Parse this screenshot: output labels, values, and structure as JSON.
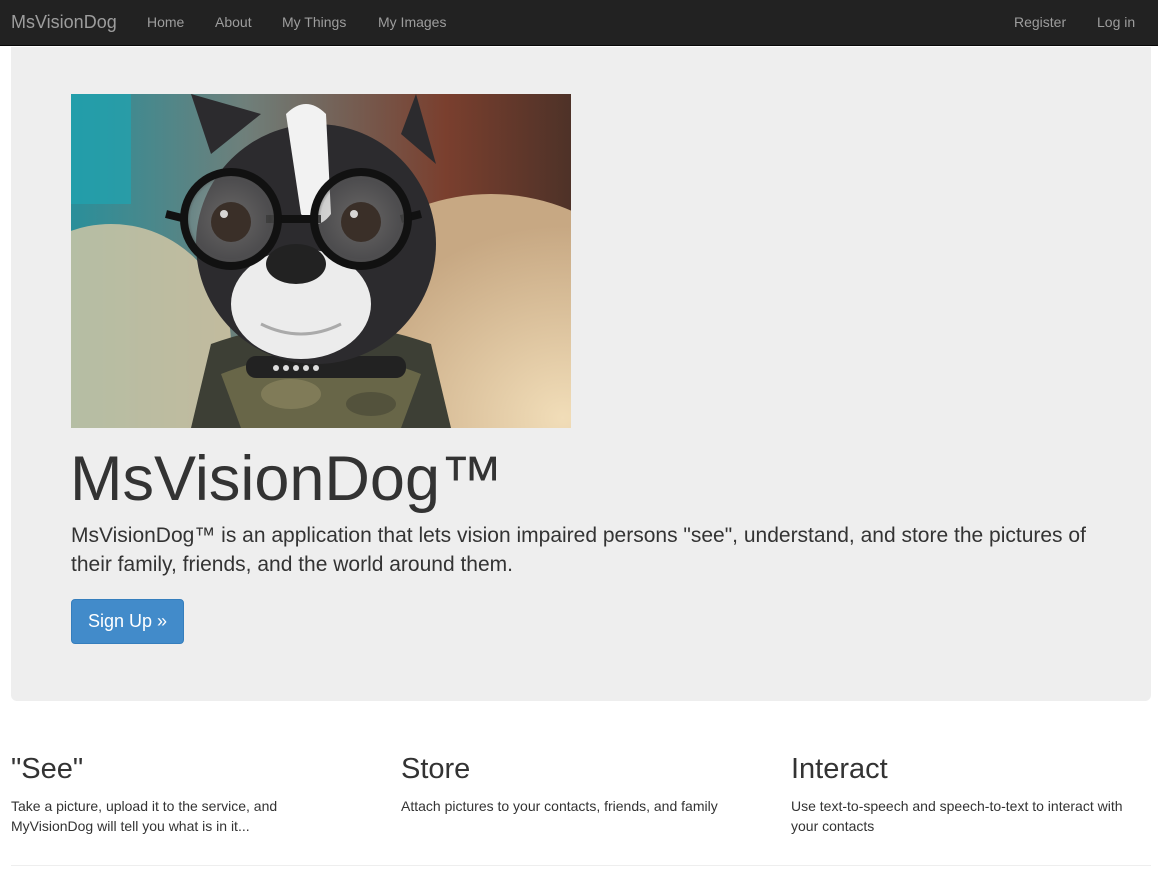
{
  "navbar": {
    "brand": "MsVisionDog",
    "links": [
      "Home",
      "About",
      "My Things",
      "My Images"
    ],
    "right_links": [
      "Register",
      "Log in"
    ],
    "background": "#222222",
    "link_color": "#9d9d9d"
  },
  "hero": {
    "title": "MsVisionDog™",
    "description": "MsVisionDog™ is an application that lets vision impaired persons \"see\", understand, and store the pictures of their family, friends, and the world around them.",
    "button_label": "Sign Up »",
    "button_color": "#428bca",
    "background": "#eeeeee"
  },
  "features": [
    {
      "heading": "\"See\"",
      "text": "Take a picture, upload it to the service, and MyVisionDog will tell you what is in it..."
    },
    {
      "heading": "Store",
      "text": "Attach pictures to your contacts, friends, and family"
    },
    {
      "heading": "Interact",
      "text": "Use text-to-speech and speech-to-text to interact with your contacts"
    }
  ]
}
